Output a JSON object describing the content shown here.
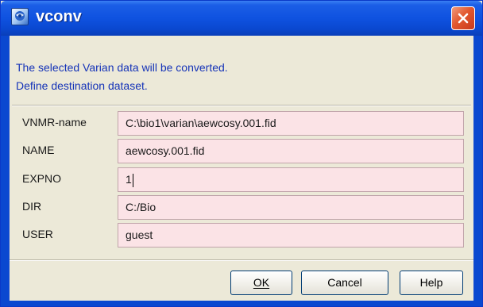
{
  "window": {
    "title": "vconv",
    "close_label": "×"
  },
  "message": {
    "line1": "The selected Varian data will be converted.",
    "line2": "Define destination dataset."
  },
  "fields": [
    {
      "label": "VNMR-name",
      "value": "C:\\bio1\\varian\\aewcosy.001.fid"
    },
    {
      "label": "NAME",
      "value": "aewcosy.001.fid"
    },
    {
      "label": "EXPNO",
      "value": "1"
    },
    {
      "label": "DIR",
      "value": "C:/Bio"
    },
    {
      "label": "USER",
      "value": "guest"
    }
  ],
  "buttons": {
    "ok": "OK",
    "cancel": "Cancel",
    "help": "Help"
  },
  "colors": {
    "titlebar": "#0a48d0",
    "field_background": "#fbe3e6",
    "message_text": "#1533b8",
    "close_button": "#e2582f"
  },
  "icons": {
    "app": "app-logo-icon",
    "close": "close-icon"
  }
}
